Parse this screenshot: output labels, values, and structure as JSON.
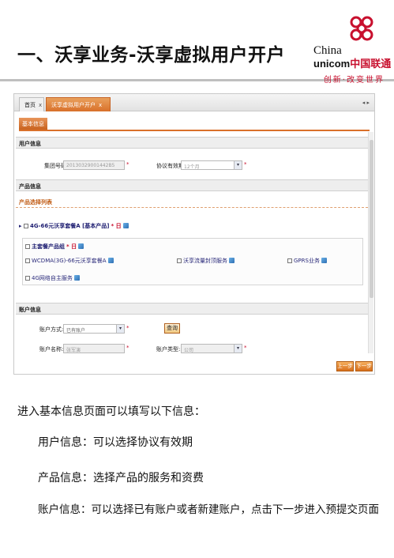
{
  "slide": {
    "title": "一、沃享业务-沃享虚拟用户开户",
    "logo": {
      "line1": "China",
      "line2_a": "unicom",
      "line2_b": "中国联通",
      "slogan": "创新·改变世界"
    }
  },
  "app": {
    "tabs": [
      {
        "label": "首页",
        "close": "x"
      },
      {
        "label": "沃享虚拟用户开户",
        "close": "x"
      }
    ],
    "tab_controls": "◂ ▸",
    "subtab": "基本信息",
    "user_section": {
      "title": "用户信息",
      "group_no_label": "集团号码",
      "group_no_value": "20130329001442B5",
      "term_label": "协议有效期",
      "term_value": "12个月",
      "required": "*"
    },
    "product_section": {
      "title": "产品信息",
      "list_title": "产品选择列表",
      "base_package": "4G-66元沃享套餐A [基本产品]",
      "base_suffix": "* 日",
      "main_group": "主套餐产品组",
      "main_group_suffix": "* 日",
      "items": [
        "WCDMA(3G)-66元沃享套餐A",
        "沃享流量封顶服务",
        "GPRS业务",
        "4G网络自主服务"
      ]
    },
    "account_section": {
      "title": "账户信息",
      "mode_label": "账户方式:",
      "mode_value": "已有账户",
      "query_button": "查询",
      "name_label": "账户名称:",
      "name_value": "张军演",
      "type_label": "账户类型:",
      "type_value": "公司"
    },
    "prev_button": "上一步",
    "next_button": "下一步"
  },
  "description": {
    "intro": "进入基本信息页面可以填写以下信息：",
    "line1": "用户信息：可以选择协议有效期",
    "line2": "产品信息：选择产品的服务和资费",
    "line3": "账户信息：可以选择已有账户或者新建账户，点击下一步进入预提交页面"
  }
}
